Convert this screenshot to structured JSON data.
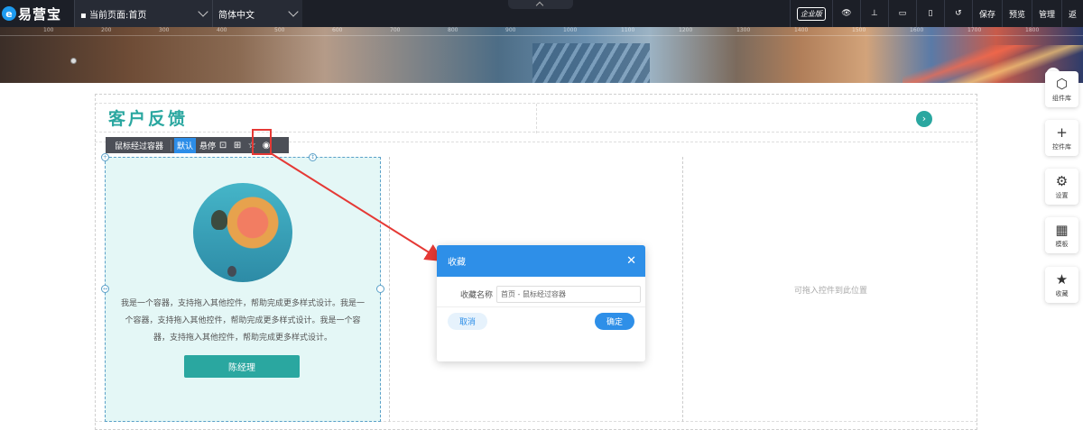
{
  "topbar": {
    "logo_mark": "e",
    "brand": "易营宝",
    "page_select": "当前页面:首页",
    "lang_select": "简体中文",
    "enterprise_badge": "企业版",
    "save": "保存",
    "preview": "预览",
    "manage": "管理",
    "back": "返"
  },
  "ruler_ticks": [
    "100",
    "200",
    "300",
    "400",
    "500",
    "600",
    "700",
    "800",
    "900",
    "1000",
    "1100",
    "1200",
    "1300",
    "1400",
    "1500",
    "1600",
    "1700",
    "1800"
  ],
  "section": {
    "title": "客户反馈",
    "toolbar": {
      "label": "鼠标经过容器",
      "default": "默认",
      "hover": "悬停"
    },
    "card": {
      "description": "我是一个容器，支持拖入其他控件，帮助完成更多样式设计。我是一个容器，支持拖入其他控件，帮助完成更多样式设计。我是一个容器，支持拖入其他控件，帮助完成更多样式设计。",
      "button": "陈经理"
    },
    "placeholder": "可拖入控件到此位置"
  },
  "dialog": {
    "title": "收藏",
    "close": "✕",
    "field_label": "收藏名称",
    "field_value": "首页 - 鼠标经过容器",
    "cancel": "取消",
    "confirm": "确定"
  },
  "right_panel": [
    {
      "icon": "cube-icon",
      "glyph": "⬡",
      "label": "组件库"
    },
    {
      "icon": "plus-icon",
      "glyph": "+",
      "label": "控件库"
    },
    {
      "icon": "gear-icon",
      "glyph": "⚙",
      "label": "设置"
    },
    {
      "icon": "template-icon",
      "glyph": "▦",
      "label": "模板"
    },
    {
      "icon": "star-icon",
      "glyph": "★",
      "label": "收藏"
    }
  ],
  "colors": {
    "accent": "#2e8fe8",
    "teal": "#2aa7a0",
    "topbar": "#1c1f27",
    "highlight": "#e53935"
  }
}
